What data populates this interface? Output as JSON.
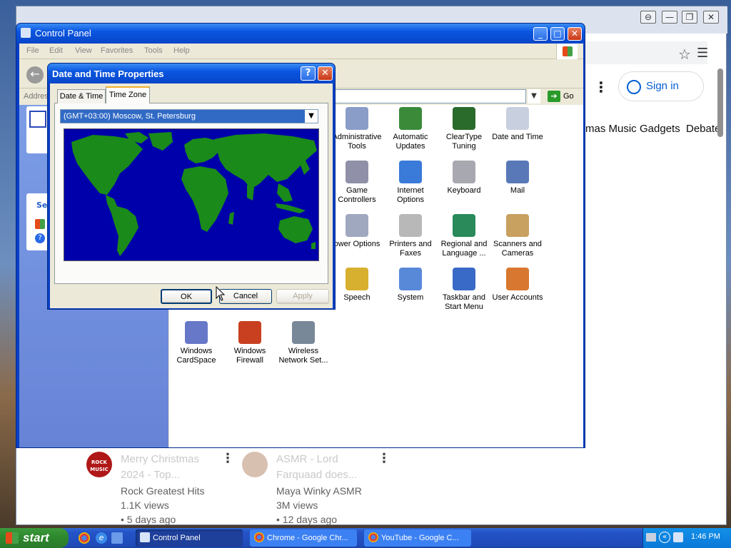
{
  "chrome": {
    "signin_label": "Sign in",
    "chips": [
      "mas Music",
      "Gadgets",
      "Debate"
    ],
    "videos": [
      {
        "title": "Merry Christmas 2024 - Top...",
        "channel": "Rock Greatest Hits",
        "views": "1.1K views",
        "age": "• 5 days ago",
        "avatar_text": "ROCK MUSIC"
      },
      {
        "title": "ASMR - Lord Farquaad does...",
        "channel": "Maya Winky ASMR",
        "views": "3M views",
        "age": "• 12 days ago"
      }
    ],
    "window_controls": [
      "⊖",
      "—",
      "❐",
      "✕"
    ]
  },
  "control_panel": {
    "title": "Control Panel",
    "menu": [
      "File",
      "Edit",
      "View",
      "Favorites",
      "Tools",
      "Help"
    ],
    "address_label": "Addres",
    "go_label": "Go",
    "sidebar_partial": "Se",
    "icons": [
      {
        "label": "Administrative Tools",
        "icon": "admin-tools-icon",
        "color": "#8a9cc8"
      },
      {
        "label": "Automatic Updates",
        "icon": "windows-flag-icon",
        "color": "#3a8a3a"
      },
      {
        "label": "ClearType Tuning",
        "icon": "cleartype-icon",
        "color": "#2a6a2a"
      },
      {
        "label": "Date and Time",
        "icon": "clock-icon",
        "color": "#c8d0e0"
      },
      {
        "label": "Game Controllers",
        "icon": "gamepad-icon",
        "color": "#9090a8"
      },
      {
        "label": "Internet Options",
        "icon": "globe-icon",
        "color": "#3a7ad8"
      },
      {
        "label": "Keyboard",
        "icon": "keyboard-icon",
        "color": "#a8a8b0"
      },
      {
        "label": "Mail",
        "icon": "mail-icon",
        "color": "#5878b8"
      },
      {
        "label": "ower Options",
        "icon": "power-icon",
        "color": "#a0a8c0"
      },
      {
        "label": "Printers and Faxes",
        "icon": "printer-icon",
        "color": "#b8b8b8"
      },
      {
        "label": "Regional and Language ...",
        "icon": "globe-icon",
        "color": "#2a8a5a"
      },
      {
        "label": "Scanners and Cameras",
        "icon": "scanner-icon",
        "color": "#c8a060"
      },
      {
        "label": "Speech",
        "icon": "speech-icon",
        "color": "#d8b030"
      },
      {
        "label": "System",
        "icon": "monitor-icon",
        "color": "#5888d8"
      },
      {
        "label": "Taskbar and Start Menu",
        "icon": "taskbar-icon",
        "color": "#3a6ac8"
      },
      {
        "label": "User Accounts",
        "icon": "users-icon",
        "color": "#d87830"
      },
      {
        "label": "Windows CardSpace",
        "icon": "cardspace-icon",
        "color": "#6878c8"
      },
      {
        "label": "Windows Firewall",
        "icon": "firewall-icon",
        "color": "#c84020"
      },
      {
        "label": "Wireless Network Set...",
        "icon": "wireless-icon",
        "color": "#788898"
      }
    ]
  },
  "dialog": {
    "title": "Date and Time Properties",
    "help_glyph": "?",
    "close_glyph": "✕",
    "tabs": [
      "Date & Time",
      "Time Zone"
    ],
    "active_tab": "Time Zone",
    "timezone_value": "(GMT+03:00) Moscow, St. Petersburg",
    "buttons": {
      "ok": "OK",
      "cancel": "Cancel",
      "apply": "Apply"
    },
    "map_colors": {
      "ocean": "#0000aa",
      "land": "#1a8a1a"
    }
  },
  "taskbar": {
    "start_label": "start",
    "tasks": [
      {
        "label": "Control Panel",
        "active": true
      },
      {
        "label": "Chrome - Google Chr...",
        "active": false
      },
      {
        "label": "YouTube - Google C...",
        "active": false
      }
    ],
    "clock": "1:46 PM"
  }
}
